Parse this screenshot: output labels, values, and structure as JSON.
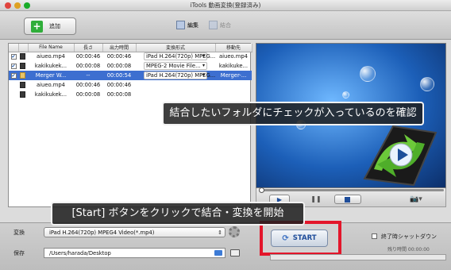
{
  "window": {
    "title": "iTools 動画変換(登録済み)"
  },
  "toolbar": {
    "add_label": "追加",
    "edit_label": "編集",
    "merge_label": "結合"
  },
  "table": {
    "columns": [
      "File Name",
      "長さ",
      "出力時間",
      "変換形式",
      "移動先"
    ],
    "rows": [
      {
        "checked": true,
        "name": "aiueo.mp4",
        "length": "00:00:46",
        "output": "00:00:46",
        "format": "iPad H.264(720p) MPEG...",
        "dest": "aiueo.mp4",
        "selected": false
      },
      {
        "checked": true,
        "name": "kakikukek...",
        "length": "00:00:08",
        "output": "00:00:08",
        "format": "MPEG-2 Movie File...",
        "dest": "kakikuke...",
        "selected": false
      },
      {
        "checked": true,
        "name": "Merger W...",
        "length": "--",
        "output": "00:00:54",
        "format": "iPad H.264(720p) MPEG...",
        "dest": "Merger-...",
        "selected": true
      },
      {
        "checked": false,
        "name": "aiueo.mp4",
        "length": "00:00:46",
        "output": "00:00:46",
        "format": "",
        "dest": "",
        "selected": false
      },
      {
        "checked": false,
        "name": "kakikukek...",
        "length": "00:00:08",
        "output": "00:00:08",
        "format": "",
        "dest": "",
        "selected": false
      }
    ]
  },
  "callouts": {
    "top": "結合したいフォルダにチェックが入っているのを確認",
    "bottom": "[Start] ボタンをクリックで結合・変換を開始"
  },
  "bottom": {
    "convert_label": "変換",
    "convert_value": "iPad H.264(720p) MPEG4 Video(*.mp4)",
    "save_label": "保存",
    "save_path": "/Users/harada/Desktop",
    "start_label": "START",
    "shutdown_label": "終了時シャットダウン",
    "remaining_label": "残り時間 00:00:00"
  },
  "colors": {
    "highlight": "#e3162a",
    "selection": "#3d6fd0",
    "start_text": "#1f4d9a"
  }
}
